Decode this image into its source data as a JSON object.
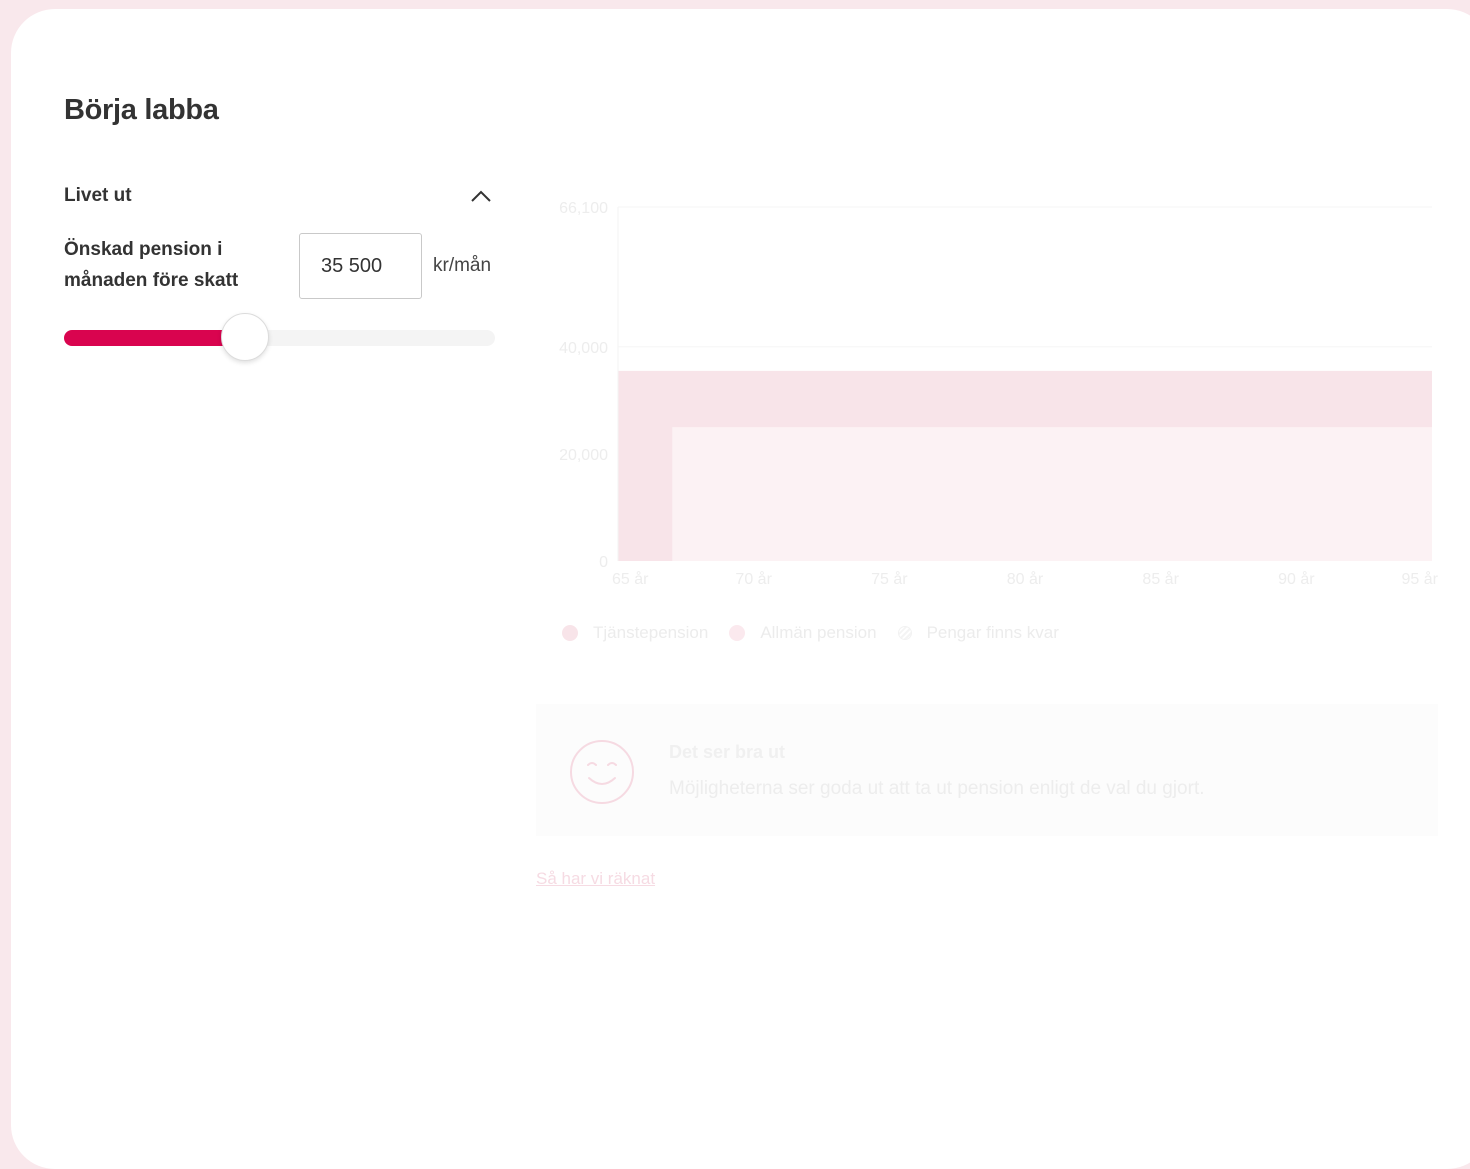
{
  "colors": {
    "accent": "#d9044f",
    "page_background": "#f9e8ec",
    "tjanstepension": "#f8e4e9",
    "allman_pension": "#fcf2f4"
  },
  "page": {
    "title": "Börja labba"
  },
  "section": {
    "title": "Livet ut",
    "toggle_icon": "chevron-up-icon"
  },
  "pension_input": {
    "label": "Önskad pension i månaden före skatt",
    "value": "35 500",
    "unit": "kr/mån"
  },
  "slider": {
    "fraction": 0.42
  },
  "chart_data": {
    "type": "area",
    "x_tick_labels": [
      "65 år",
      "70 år",
      "75 år",
      "80 år",
      "85 år",
      "90 år",
      "95 år"
    ],
    "y_tick_labels": [
      "0",
      "20,000",
      "40,000",
      "66,100"
    ],
    "y_ticks": [
      0,
      20000,
      40000,
      66100
    ],
    "ylim": [
      0,
      66100
    ],
    "xlim": [
      65,
      95
    ],
    "grid": true,
    "series": [
      {
        "name": "Tjänstepension",
        "color": "#f8e4e9",
        "points": [
          [
            65,
            35500
          ],
          [
            95,
            35500
          ]
        ]
      },
      {
        "name": "Allmän pension",
        "color": "#fcf2f4",
        "points": [
          [
            65,
            0
          ],
          [
            67,
            0
          ],
          [
            67,
            25000
          ],
          [
            95,
            25000
          ]
        ]
      }
    ]
  },
  "legend": {
    "items": [
      {
        "label": "Tjänstepension",
        "color": "#f8e4e9",
        "icon": "dot"
      },
      {
        "label": "Allmän pension",
        "color": "#fbe9ee",
        "icon": "dot"
      },
      {
        "label": "Pengar finns kvar",
        "color": "#f4f4f4",
        "icon": "hatch"
      }
    ]
  },
  "status": {
    "icon": "smiley-icon",
    "title": "Det ser bra ut",
    "text": "Möjligheterna ser goda ut att ta ut pension enligt de val du gjort."
  },
  "link": {
    "label": "Så har vi räknat"
  }
}
